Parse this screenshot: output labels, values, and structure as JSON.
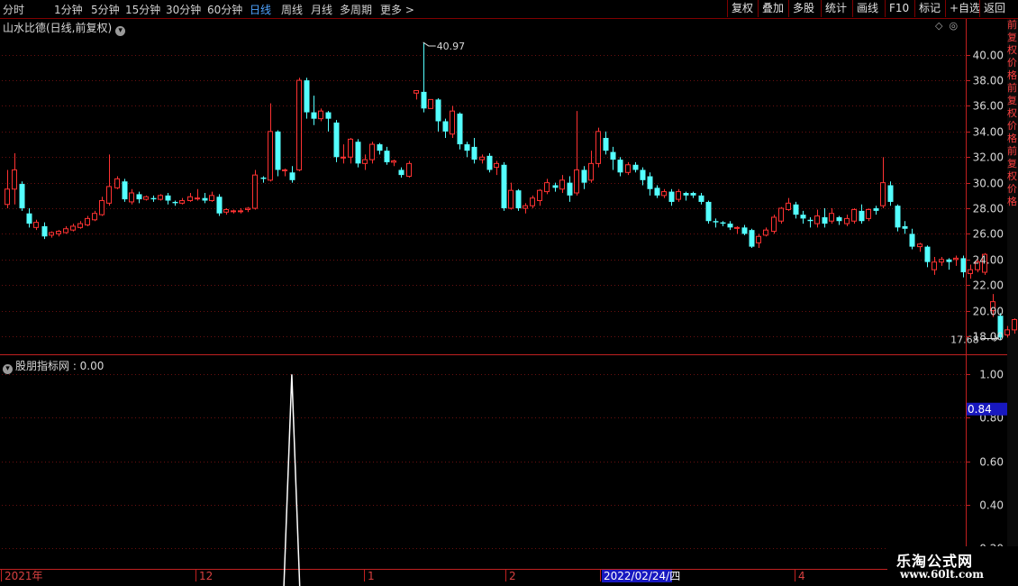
{
  "toolbar": {
    "periods": [
      "分时",
      "1分钟",
      "5分钟",
      "15分钟",
      "30分钟",
      "60分钟",
      "日线",
      "周线",
      "月线",
      "多周期",
      "更多"
    ],
    "active_period": "日线",
    "more_arrow": ">",
    "buttons": [
      "复权",
      "叠加",
      "多股",
      "统计",
      "画线",
      "F10",
      "标记",
      "+自选",
      "返回"
    ]
  },
  "chart_title": "山水比德(日线,前复权)",
  "indicator_title": "股朋指标网 : 0.00",
  "right_strip_text": "前复权价格前复权价格前复权价格",
  "watermark": {
    "line1": "乐淘公式网",
    "line2": "www.60lt.com"
  },
  "colors": {
    "up": "#ff3232",
    "down": "#54ffff",
    "axis": "#c02020",
    "grid": "#6a1010",
    "indicator": "#ffffff",
    "label_bg": "#1818c0"
  },
  "chart_data": [
    {
      "type": "candlestick",
      "title": "山水比德(日线,前复权)",
      "ylim": [
        16.8,
        41.6
      ],
      "y_ticks": [
        "18.00",
        "20.00",
        "22.00",
        "24.00",
        "26.00",
        "28.00",
        "30.00",
        "32.00",
        "34.00",
        "36.00",
        "38.00",
        "40.00"
      ],
      "max_label": "40.97",
      "min_label": "17.68",
      "x_labels": [
        "2021年",
        "12",
        "1",
        "2",
        "2022/02/24/四",
        "4"
      ],
      "candles": [
        [
          28.3,
          29.5,
          28.0,
          31.0
        ],
        [
          29.5,
          31.0,
          28.3,
          32.3
        ],
        [
          29.9,
          28.0,
          27.8,
          30.1
        ],
        [
          27.6,
          26.8,
          26.5,
          28.0
        ],
        [
          26.5,
          26.9,
          26.3,
          27.1
        ],
        [
          26.6,
          25.8,
          25.6,
          26.9
        ],
        [
          25.9,
          26.1,
          25.7,
          26.2
        ],
        [
          26.0,
          26.2,
          25.8,
          26.3
        ],
        [
          26.1,
          26.4,
          26.0,
          26.6
        ],
        [
          26.3,
          26.6,
          26.2,
          26.8
        ],
        [
          26.5,
          26.8,
          26.4,
          27.0
        ],
        [
          26.7,
          27.2,
          26.6,
          27.4
        ],
        [
          27.1,
          27.6,
          27.0,
          27.8
        ],
        [
          27.5,
          28.6,
          27.4,
          28.9
        ],
        [
          28.4,
          29.7,
          28.2,
          32.2
        ],
        [
          29.6,
          30.3,
          29.5,
          30.5
        ],
        [
          30.1,
          28.7,
          28.5,
          30.3
        ],
        [
          28.5,
          29.2,
          28.3,
          29.5
        ],
        [
          29.1,
          28.7,
          28.4,
          29.3
        ],
        [
          28.7,
          28.9,
          28.6,
          29.0
        ],
        [
          28.8,
          28.7,
          28.5,
          29.0
        ],
        [
          28.7,
          29.0,
          28.6,
          29.1
        ],
        [
          29.0,
          28.6,
          28.3,
          29.2
        ],
        [
          28.5,
          28.4,
          28.2,
          28.6
        ],
        [
          28.4,
          28.6,
          28.3,
          28.8
        ],
        [
          28.6,
          28.9,
          28.5,
          29.2
        ],
        [
          28.8,
          28.8,
          28.6,
          29.5
        ],
        [
          28.8,
          28.6,
          28.4,
          29.2
        ],
        [
          28.6,
          29.0,
          28.5,
          29.3
        ],
        [
          28.9,
          27.6,
          27.4,
          29.1
        ],
        [
          27.7,
          27.9,
          27.5,
          28.0
        ],
        [
          27.8,
          27.8,
          27.6,
          27.9
        ],
        [
          27.8,
          27.8,
          27.6,
          28.0
        ],
        [
          27.9,
          28.0,
          27.7,
          28.1
        ],
        [
          28.0,
          30.6,
          27.9,
          31.0
        ],
        [
          30.4,
          30.3,
          30.0,
          30.5
        ],
        [
          30.2,
          34.0,
          30.1,
          36.2
        ],
        [
          34.0,
          31.0,
          30.5,
          34.1
        ],
        [
          31.0,
          31.0,
          30.5,
          31.1
        ],
        [
          30.8,
          30.2,
          30.0,
          31.3
        ],
        [
          31.0,
          38.0,
          30.9,
          38.2
        ],
        [
          38.0,
          35.5,
          35.0,
          38.2
        ],
        [
          35.5,
          35.0,
          34.5,
          36.8
        ],
        [
          35.0,
          35.6,
          34.8,
          35.8
        ],
        [
          35.5,
          35.0,
          34.0,
          35.6
        ],
        [
          34.7,
          32.0,
          31.6,
          34.9
        ],
        [
          32.0,
          32.0,
          31.5,
          33.0
        ],
        [
          32.0,
          33.4,
          31.5,
          33.5
        ],
        [
          33.2,
          31.5,
          31.2,
          33.4
        ],
        [
          31.5,
          31.8,
          31.0,
          32.2
        ],
        [
          31.8,
          33.0,
          31.5,
          33.2
        ],
        [
          33.0,
          32.5,
          32.2,
          33.1
        ],
        [
          32.5,
          31.6,
          31.4,
          32.8
        ],
        [
          31.6,
          31.7,
          31.3,
          31.8
        ],
        [
          31.0,
          30.6,
          30.4,
          31.2
        ],
        [
          30.5,
          31.5,
          30.4,
          31.7
        ],
        [
          37.0,
          37.2,
          36.5,
          37.2
        ],
        [
          37.1,
          35.8,
          35.5,
          40.97
        ],
        [
          35.8,
          36.5,
          36.0,
          36.5
        ],
        [
          36.5,
          34.8,
          34.0,
          36.6
        ],
        [
          34.8,
          34.0,
          33.5,
          35.0
        ],
        [
          33.8,
          35.6,
          33.5,
          36.0
        ],
        [
          35.4,
          33.0,
          32.6,
          35.5
        ],
        [
          33.0,
          32.5,
          32.0,
          33.2
        ],
        [
          32.8,
          31.8,
          31.5,
          33.5
        ],
        [
          31.8,
          32.0,
          31.5,
          32.2
        ],
        [
          32.1,
          31.0,
          30.8,
          32.3
        ],
        [
          31.2,
          31.5,
          30.6,
          31.7
        ],
        [
          31.4,
          28.0,
          27.8,
          31.6
        ],
        [
          28.0,
          29.4,
          27.9,
          30.0
        ],
        [
          29.4,
          28.0,
          27.8,
          29.5
        ],
        [
          28.0,
          28.2,
          27.6,
          28.4
        ],
        [
          28.2,
          28.8,
          28.0,
          29.0
        ],
        [
          28.6,
          29.4,
          28.2,
          29.5
        ],
        [
          29.3,
          30.0,
          29.1,
          30.3
        ],
        [
          29.8,
          29.6,
          29.3,
          30.0
        ],
        [
          29.5,
          30.2,
          29.2,
          30.6
        ],
        [
          30.0,
          29.0,
          28.5,
          30.5
        ],
        [
          29.2,
          31.0,
          29.0,
          35.6
        ],
        [
          31.0,
          30.0,
          29.5,
          31.3
        ],
        [
          30.2,
          31.5,
          30.0,
          32.5
        ],
        [
          31.5,
          34.0,
          31.2,
          34.3
        ],
        [
          33.5,
          32.5,
          32.2,
          34.0
        ],
        [
          32.4,
          31.8,
          31.0,
          32.8
        ],
        [
          31.8,
          30.8,
          30.5,
          32.0
        ],
        [
          30.8,
          31.4,
          30.6,
          31.6
        ],
        [
          31.4,
          31.0,
          30.8,
          31.6
        ],
        [
          31.0,
          30.2,
          29.8,
          31.2
        ],
        [
          30.5,
          29.5,
          29.0,
          30.8
        ],
        [
          29.6,
          29.0,
          28.8,
          29.8
        ],
        [
          29.0,
          29.3,
          28.8,
          29.5
        ],
        [
          29.3,
          28.5,
          28.2,
          29.5
        ],
        [
          28.7,
          29.3,
          28.5,
          29.5
        ],
        [
          29.2,
          29.0,
          28.6,
          29.3
        ],
        [
          29.2,
          29.0,
          28.8,
          29.3
        ],
        [
          29.0,
          28.5,
          28.3,
          29.2
        ],
        [
          28.5,
          27.0,
          26.8,
          28.6
        ],
        [
          27.0,
          26.9,
          26.5,
          27.2
        ],
        [
          26.9,
          26.8,
          26.6,
          27.0
        ],
        [
          26.8,
          26.5,
          26.3,
          27.0
        ],
        [
          26.5,
          26.5,
          26.0,
          26.6
        ],
        [
          26.5,
          26.0,
          25.9,
          26.7
        ],
        [
          26.3,
          25.0,
          24.9,
          26.4
        ],
        [
          25.3,
          25.8,
          24.9,
          26.0
        ],
        [
          25.9,
          26.3,
          25.8,
          26.5
        ],
        [
          26.2,
          27.3,
          26.0,
          27.5
        ],
        [
          27.0,
          28.0,
          26.8,
          28.1
        ],
        [
          27.9,
          28.4,
          27.8,
          28.8
        ],
        [
          28.3,
          27.5,
          27.2,
          28.5
        ],
        [
          27.5,
          27.2,
          26.8,
          27.8
        ],
        [
          27.1,
          27.0,
          26.5,
          27.3
        ],
        [
          26.8,
          27.4,
          26.5,
          27.9
        ],
        [
          27.3,
          26.8,
          26.5,
          28.0
        ],
        [
          27.0,
          27.6,
          26.8,
          28.0
        ],
        [
          27.3,
          27.0,
          26.7,
          27.4
        ],
        [
          26.8,
          27.2,
          26.6,
          27.5
        ],
        [
          27.0,
          27.9,
          26.8,
          28.0
        ],
        [
          27.8,
          27.0,
          26.8,
          28.3
        ],
        [
          27.2,
          27.9,
          27.0,
          28.0
        ],
        [
          28.0,
          27.8,
          27.5,
          28.2
        ],
        [
          28.2,
          30.0,
          28.0,
          32.0
        ],
        [
          29.8,
          28.5,
          28.2,
          30.1
        ],
        [
          28.2,
          26.5,
          26.2,
          28.3
        ],
        [
          26.6,
          26.4,
          26.0,
          27.0
        ],
        [
          26.0,
          25.0,
          24.8,
          26.4
        ],
        [
          25.0,
          25.2,
          24.6,
          25.3
        ],
        [
          25.0,
          23.8,
          23.4,
          25.1
        ],
        [
          23.2,
          23.8,
          22.8,
          24.2
        ],
        [
          23.8,
          24.0,
          23.5,
          24.2
        ],
        [
          24.0,
          23.8,
          23.2,
          24.1
        ],
        [
          24.0,
          24.1,
          23.5,
          24.3
        ],
        [
          24.1,
          23.0,
          22.6,
          24.3
        ],
        [
          22.9,
          23.2,
          22.5,
          23.6
        ],
        [
          23.2,
          23.8,
          23.0,
          24.0
        ],
        [
          23.0,
          24.4,
          22.8,
          24.5
        ],
        [
          20.0,
          20.7,
          19.5,
          21.3
        ],
        [
          19.6,
          17.9,
          17.68,
          19.8
        ],
        [
          18.1,
          18.5,
          17.9,
          18.8
        ],
        [
          18.5,
          19.3,
          18.2,
          19.4
        ],
        [
          19.0,
          19.4,
          18.9,
          19.5
        ],
        [
          19.2,
          19.0,
          18.6,
          19.4
        ],
        [
          19.0,
          20.2,
          18.8,
          20.4
        ],
        [
          20.1,
          21.9,
          19.8,
          23.5
        ],
        [
          22.0,
          20.0,
          19.8,
          22.1
        ]
      ]
    },
    {
      "type": "line",
      "title": "股朋指标网",
      "ylim": [
        0.12,
        1.08
      ],
      "y_ticks": [
        "0.20",
        "0.40",
        "0.60",
        "0.80",
        "1.00"
      ],
      "current_label": "0.84",
      "spike_index": 39,
      "spike_value": 1.0,
      "baseline_value": 0.0
    }
  ]
}
